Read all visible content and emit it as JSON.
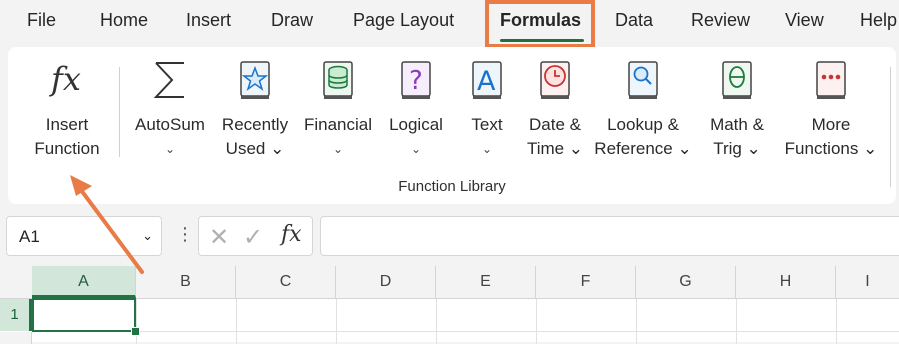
{
  "tabs": [
    "File",
    "Home",
    "Insert",
    "Draw",
    "Page Layout",
    "Formulas",
    "Data",
    "Review",
    "View",
    "Help"
  ],
  "active_tab": "Formulas",
  "ribbon": {
    "insert_function": {
      "line1": "Insert",
      "line2": "Function"
    },
    "autosum": {
      "line1": "AutoSum",
      "chev": "⌄"
    },
    "recently_used": {
      "line1": "Recently",
      "line2": "Used ⌄"
    },
    "financial": {
      "line1": "Financial",
      "chev": "⌄"
    },
    "logical": {
      "line1": "Logical",
      "chev": "⌄"
    },
    "text": {
      "line1": "Text",
      "chev": "⌄"
    },
    "date_time": {
      "line1": "Date &",
      "line2": "Time ⌄"
    },
    "lookup_reference": {
      "line1": "Lookup &",
      "line2": "Reference ⌄"
    },
    "math_trig": {
      "line1": "Math &",
      "line2": "Trig ⌄"
    },
    "more_functions": {
      "line1": "More",
      "line2": "Functions ⌄"
    },
    "group_label": "Function Library"
  },
  "formula_bar": {
    "name_box": "A1",
    "name_box_chevron": "⌄",
    "fx_label": "fx",
    "formula_value": ""
  },
  "grid": {
    "columns": [
      "A",
      "B",
      "C",
      "D",
      "E",
      "F",
      "G",
      "H",
      "I"
    ],
    "rows": [
      "1"
    ],
    "active_cell": "A1"
  },
  "colors": {
    "accent_green": "#217346",
    "highlight_orange": "#e97b46"
  },
  "icons": [
    "fx-icon",
    "sigma-icon",
    "star-book-icon",
    "coins-book-icon",
    "question-book-icon",
    "text-book-icon",
    "clock-book-icon",
    "magnifier-book-icon",
    "theta-book-icon",
    "dots-book-icon"
  ]
}
